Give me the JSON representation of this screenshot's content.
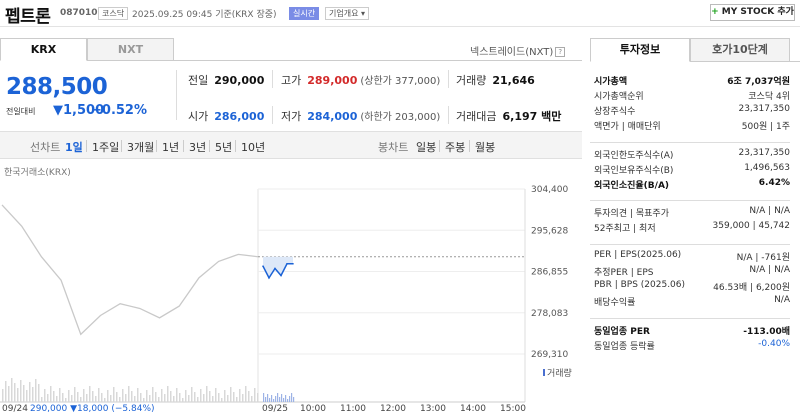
{
  "header": {
    "title": "펩트론",
    "code": "087010",
    "market_badge": "코스닥",
    "timestamp": "2025.09.25 09:45 기준(KRX 장중)",
    "realtime_badge": "실시간",
    "company_overview": "기업개요",
    "mystock_label": "MY STOCK 추가"
  },
  "tabs": {
    "krx": "KRX",
    "nxt": "NXT",
    "nextrade": "넥스트레이드(NXT)"
  },
  "summary": {
    "price": "288,500",
    "change_label": "전일대비",
    "change_value": "▼1,500",
    "change_pct": "−0.52%"
  },
  "stats": {
    "prev_label": "전일",
    "prev_value": "290,000",
    "high_label": "고가",
    "high_value": "289,000",
    "high_sub": "(상한가 377,000)",
    "vol_label": "거래량",
    "vol_value": "21,646",
    "open_label": "시가",
    "open_value": "286,000",
    "low_label": "저가",
    "low_value": "284,000",
    "low_sub": "(하한가 203,000)",
    "amt_label": "거래대금",
    "amt_value": "6,197 백만"
  },
  "periods": {
    "line_chart": "선차트",
    "items": [
      "1일",
      "1주일",
      "3개월",
      "1년",
      "3년",
      "5년",
      "10년"
    ],
    "candle_chart": "봉차트",
    "candle_items": [
      "일봉",
      "주봉",
      "월봉"
    ]
  },
  "chart": {
    "source": "한국거래소(KRX)",
    "volume_label": "거래량",
    "prev_day": "09/24",
    "prev_summary": "290,000 ▼18,000 (−5.84%)",
    "colors": {
      "up": "#d32a2a",
      "down": "#1c63d6"
    }
  },
  "chart_data": {
    "type": "line",
    "ylim": [
      269310,
      304400
    ],
    "yticks": [
      "304,400",
      "295,628",
      "286,855",
      "278,083",
      "269,310"
    ],
    "xticks": [
      "09/24",
      "09/25",
      "10:00",
      "11:00",
      "12:00",
      "13:00",
      "14:00",
      "15:00"
    ],
    "prev_close": 290000,
    "series": [
      {
        "x": [
          "09/24 09:00",
          "09/24 09:30",
          "09/24 10:00",
          "09/24 10:30",
          "09/24 11:00",
          "09/24 11:30",
          "09/24 12:00",
          "09/24 12:30",
          "09/24 13:00",
          "09/24 13:30",
          "09/24 14:00",
          "09/24 14:30",
          "09/24 15:00",
          "09/24 15:30"
        ],
        "values": [
          301000,
          296500,
          290000,
          285000,
          273500,
          277500,
          280000,
          279000,
          277000,
          279500,
          285500,
          289000,
          290500,
          290000
        ]
      },
      {
        "x": [
          "09:00",
          "09:10",
          "09:20",
          "09:30",
          "09:40",
          "09:45"
        ],
        "values": [
          288000,
          285500,
          287500,
          286000,
          288500,
          288500
        ]
      }
    ]
  },
  "right": {
    "tab_invest": "투자정보",
    "tab_quote": "호가10단계",
    "rows1": [
      {
        "k": "시가총액",
        "v": "6조 7,037억원",
        "bold": true
      },
      {
        "k": "시가총액순위",
        "v": "코스닥 4위"
      },
      {
        "k": "상장주식수",
        "v": "23,317,350"
      },
      {
        "k": "액면가 | 매매단위",
        "v": "500원 | 1주"
      }
    ],
    "rows2": [
      {
        "k": "외국인한도주식수(A)",
        "v": "23,317,350"
      },
      {
        "k": "외국인보유주식수(B)",
        "v": "1,496,563"
      },
      {
        "k": "외국인소진율(B/A)",
        "v": "6.42%",
        "bold": true
      }
    ],
    "rows3": [
      {
        "k": "투자의견 | 목표주가",
        "v": "N/A | N/A"
      },
      {
        "k": "52주최고 | 최저",
        "v": "359,000 | 45,742"
      }
    ],
    "rows4": [
      {
        "k": "PER | EPS(2025.06)",
        "v": "N/A | -761원"
      },
      {
        "k": "추정PER | EPS",
        "v": "N/A | N/A"
      },
      {
        "k": "PBR | BPS (2025.06)",
        "v": "46.53배 | 6,200원"
      },
      {
        "k": "배당수익률",
        "v": "N/A"
      }
    ],
    "rows5": [
      {
        "k": "동일업종 PER",
        "v": "-113.00배",
        "bold": true
      },
      {
        "k": "동일업종 등락률",
        "v": "-0.40%",
        "blue": true
      }
    ]
  }
}
